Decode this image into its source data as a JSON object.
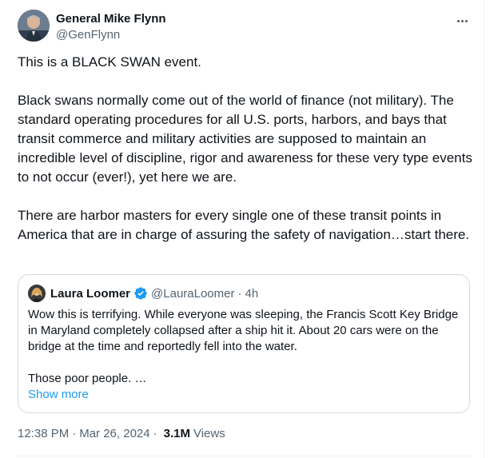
{
  "author": {
    "display_name": "General Mike Flynn",
    "handle": "@GenFlynn",
    "avatar_icon": "user-avatar"
  },
  "tweet": {
    "paragraphs": [
      "This is a BLACK SWAN event.",
      "Black swans normally come out of the world of finance (not military). The standard operating procedures for all U.S. ports, harbors, and bays that transit commerce and military activities are supposed to maintain an incredible level of discipline, rigor and awareness for these very type events to not occur (ever!), yet here we are.",
      "There are harbor masters for every single one of these transit points in America that are in charge of assuring the safety of navigation…start there."
    ]
  },
  "quoted": {
    "display_name": "Laura Loomer",
    "verified_icon": "verified-badge-icon",
    "handle": "@LauraLoomer",
    "separator": "·",
    "time": "4h",
    "paragraphs": [
      "Wow this is terrifying. While everyone was sleeping, the Francis Scott Key Bridge in Maryland completely collapsed after a ship hit it. About 20 cars were on the bridge at the time and reportedly fell into the water.",
      "Those poor people. …"
    ],
    "show_more": "Show more"
  },
  "meta": {
    "time": "12:38 PM",
    "separator": "·",
    "date": "Mar 26, 2024",
    "views_count": "3.1M",
    "views_label": "Views"
  },
  "colors": {
    "text": "#0f1419",
    "secondary": "#536471",
    "link": "#1d9bf0",
    "border": "#cfd9de"
  }
}
